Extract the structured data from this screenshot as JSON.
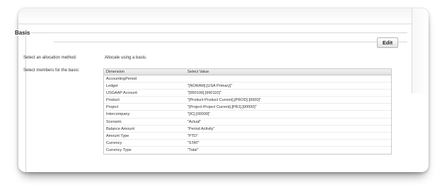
{
  "section": {
    "legend": "Basis"
  },
  "toolbar": {
    "edit_label": "Edit"
  },
  "allocation": {
    "method_label": "Select an allocation method:",
    "method_value": "Allocate using a basis."
  },
  "members": {
    "label": "Select members for the basis:"
  },
  "table": {
    "columns": [
      "Dimension",
      "Select Value"
    ],
    "rows": [
      [
        "AccountingPeriod",
        ""
      ],
      [
        "Ledger",
        "\"[NORAM].[USA Primary]\""
      ],
      [
        "USGAAP Account",
        "\"[990100].[990110]\""
      ],
      [
        "Product",
        "\"[Product-Product Current].[PROD].[0000]\""
      ],
      [
        "Project",
        "\"[Project-Project Current].[PRJ].[00000]\""
      ],
      [
        "Intercompany",
        "\"[IC].[00000]\""
      ],
      [
        "Scenario",
        "\"Actual\""
      ],
      [
        "Balance Amount",
        "\"Period Activity\""
      ],
      [
        "Amount Type",
        "\"PTD\""
      ],
      [
        "Currency",
        "\"STAT\""
      ],
      [
        "Currency Type",
        "\"Total\""
      ]
    ]
  }
}
